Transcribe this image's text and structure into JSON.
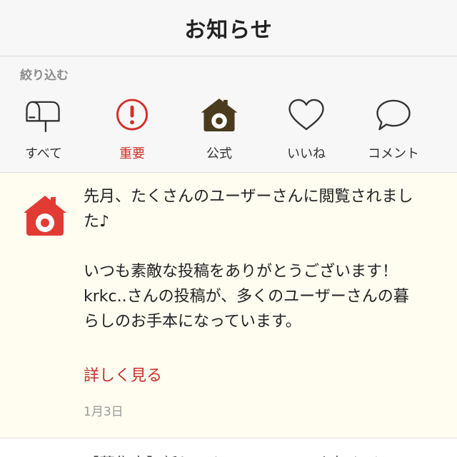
{
  "header": {
    "title": "お知らせ"
  },
  "filter": {
    "label": "絞り込む",
    "items": [
      {
        "label": "すべて",
        "icon": "mailbox-icon"
      },
      {
        "label": "重要",
        "icon": "exclamation-circle-icon"
      },
      {
        "label": "公式",
        "icon": "house-camera-icon"
      },
      {
        "label": "いいね",
        "icon": "heart-icon"
      },
      {
        "label": "コメント",
        "icon": "speech-bubble-icon"
      }
    ],
    "active_color": "#d2302c"
  },
  "notice": {
    "icon": "house-camera-icon",
    "icon_color": "#e23b34",
    "body": "先月、たくさんのユーザーさんに閲覧されました♪\n\nいつも素敵な投稿をありがとうございます！\nkrkc..さんの投稿が、多くのユーザーさんの暮らしのお手本になっています。",
    "link": "詳しく見る",
    "date": "1月3日",
    "background": "#fefdf0"
  },
  "next_item": {
    "text": "【募集中】新しいキャンペーンのお知らせ"
  }
}
